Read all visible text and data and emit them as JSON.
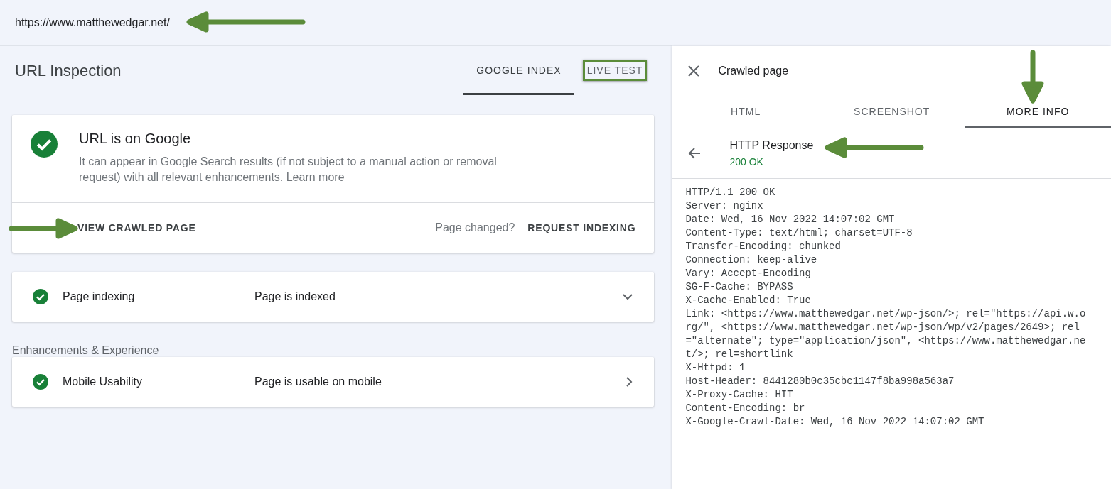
{
  "top_bar": {
    "url": "https://www.matthewedgar.net/"
  },
  "inspection": {
    "title": "URL Inspection",
    "tabs": [
      {
        "label": "GOOGLE INDEX",
        "selected": true,
        "highlighted": false
      },
      {
        "label": "LIVE TEST",
        "selected": false,
        "highlighted": true
      }
    ],
    "status_card": {
      "title": "URL is on Google",
      "description": "It can appear in Google Search results (if not subject to a manual action or removal request) with all relevant enhancements.",
      "link": "Learn more",
      "primary_action": "VIEW CRAWLED PAGE",
      "hint": "Page changed?",
      "secondary_action": "REQUEST INDEXING"
    },
    "rows": [
      {
        "kind": "expand",
        "label": "Page indexing",
        "value": "Page is indexed"
      }
    ],
    "section_label": "Enhancements & Experience",
    "enhancement_rows": [
      {
        "kind": "navigate",
        "label": "Mobile Usability",
        "value": "Page is usable on mobile"
      }
    ]
  },
  "crawled_panel": {
    "title": "Crawled page",
    "tabs": [
      {
        "label": "HTML",
        "selected": false
      },
      {
        "label": "SCREENSHOT",
        "selected": false
      },
      {
        "label": "MORE INFO",
        "selected": true
      }
    ],
    "response": {
      "title": "HTTP Response",
      "status": "200 OK"
    },
    "headers": [
      "HTTP/1.1 200 OK",
      "Server: nginx",
      "Date: Wed, 16 Nov 2022 14:07:02 GMT",
      "Content-Type: text/html; charset=UTF-8",
      "Transfer-Encoding: chunked",
      "Connection: keep-alive",
      "Vary: Accept-Encoding",
      "SG-F-Cache: BYPASS",
      "X-Cache-Enabled: True",
      "Link: <https://www.matthewedgar.net/wp-json/>; rel=\"https://api.w.o",
      "rg/\", <https://www.matthewedgar.net/wp-json/wp/v2/pages/2649>; rel",
      "=\"alternate\"; type=\"application/json\", <https://www.matthewedgar.ne",
      "t/>; rel=shortlink",
      "X-Httpd: 1",
      "Host-Header: 8441280b0c35cbc1147f8ba998a563a7",
      "X-Proxy-Cache: HIT",
      "Content-Encoding: br",
      "X-Google-Crawl-Date: Wed, 16 Nov 2022 14:07:02 GMT"
    ]
  }
}
